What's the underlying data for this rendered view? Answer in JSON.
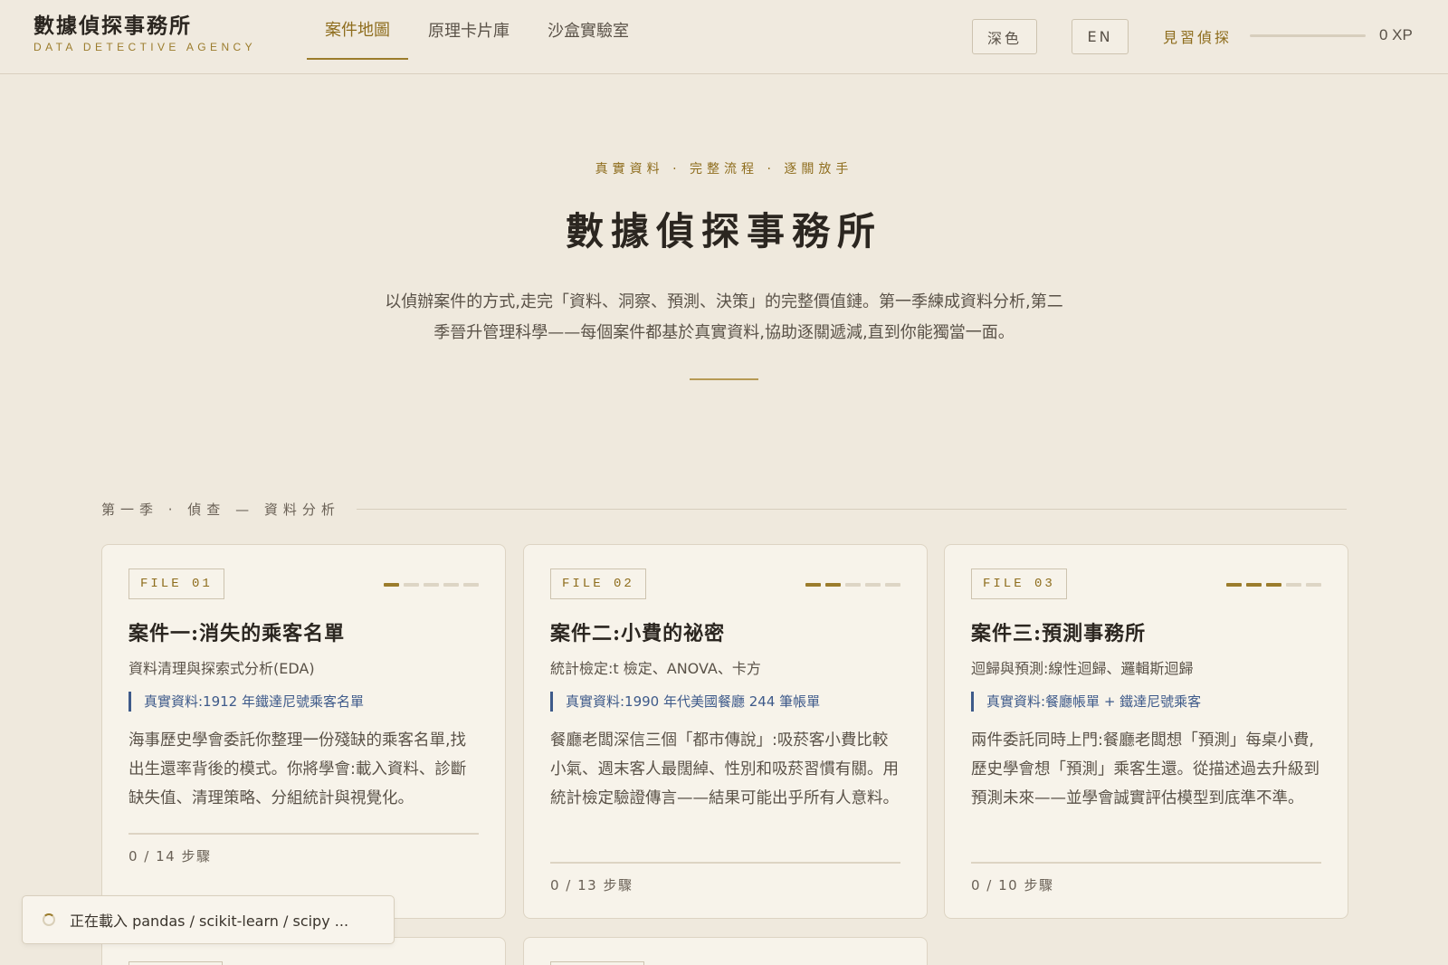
{
  "header": {
    "brand_title": "數據偵探事務所",
    "brand_subtitle": "DATA DETECTIVE AGENCY",
    "nav": [
      "案件地圖",
      "原理卡片庫",
      "沙盒實驗室"
    ],
    "theme_button": "深色",
    "lang_button": "EN",
    "rank": "見習偵探",
    "xp_progress": 0,
    "xp_text": "0 XP"
  },
  "hero": {
    "tagline": "真實資料 · 完整流程 · 逐關放手",
    "title": "數據偵探事務所",
    "description": "以偵辦案件的方式,走完「資料、洞察、預測、決策」的完整價值鏈。第一季練成資料分析,第二季晉升管理科學——每個案件都基於真實資料,協助逐關遞減,直到你能獨當一面。"
  },
  "season1": {
    "label": "第一季 · 偵查 — 資料分析"
  },
  "cards": [
    {
      "file": "FILE 01",
      "difficulty": 1,
      "title": "案件一:消失的乘客名單",
      "subtitle": "資料清理與探索式分析(EDA)",
      "data_source": "真實資料:1912 年鐵達尼號乘客名單",
      "description": "海事歷史學會委託你整理一份殘缺的乘客名單,找出生還率背後的模式。你將學會:載入資料、診斷缺失值、清理策略、分組統計與視覺化。",
      "steps": "0 / 14 步驟"
    },
    {
      "file": "FILE 02",
      "difficulty": 2,
      "title": "案件二:小費的祕密",
      "subtitle": "統計檢定:t 檢定、ANOVA、卡方",
      "data_source": "真實資料:1990 年代美國餐廳 244 筆帳單",
      "description": "餐廳老闆深信三個「都市傳說」:吸菸客小費比較小氣、週末客人最闊綽、性別和吸菸習慣有關。用統計檢定驗證傳言——結果可能出乎所有人意料。",
      "steps": "0 / 13 步驟"
    },
    {
      "file": "FILE 03",
      "difficulty": 3,
      "title": "案件三:預測事務所",
      "subtitle": "迴歸與預測:線性迴歸、邏輯斯迴歸",
      "data_source": "真實資料:餐廳帳單 + 鐵達尼號乘客",
      "description": "兩件委託同時上門:餐廳老闆想「預測」每桌小費,歷史學會想「預測」乘客生還。從描述過去升級到預測未來——並學會誠實評估模型到底準不準。",
      "steps": "0 / 10 步驟"
    }
  ],
  "toast": {
    "text": "正在載入 pandas / scikit-learn / scipy ..."
  },
  "colors": {
    "accent": "#9b7c2c",
    "data_blue": "#3e5a8a",
    "background": "#efe9dd"
  }
}
